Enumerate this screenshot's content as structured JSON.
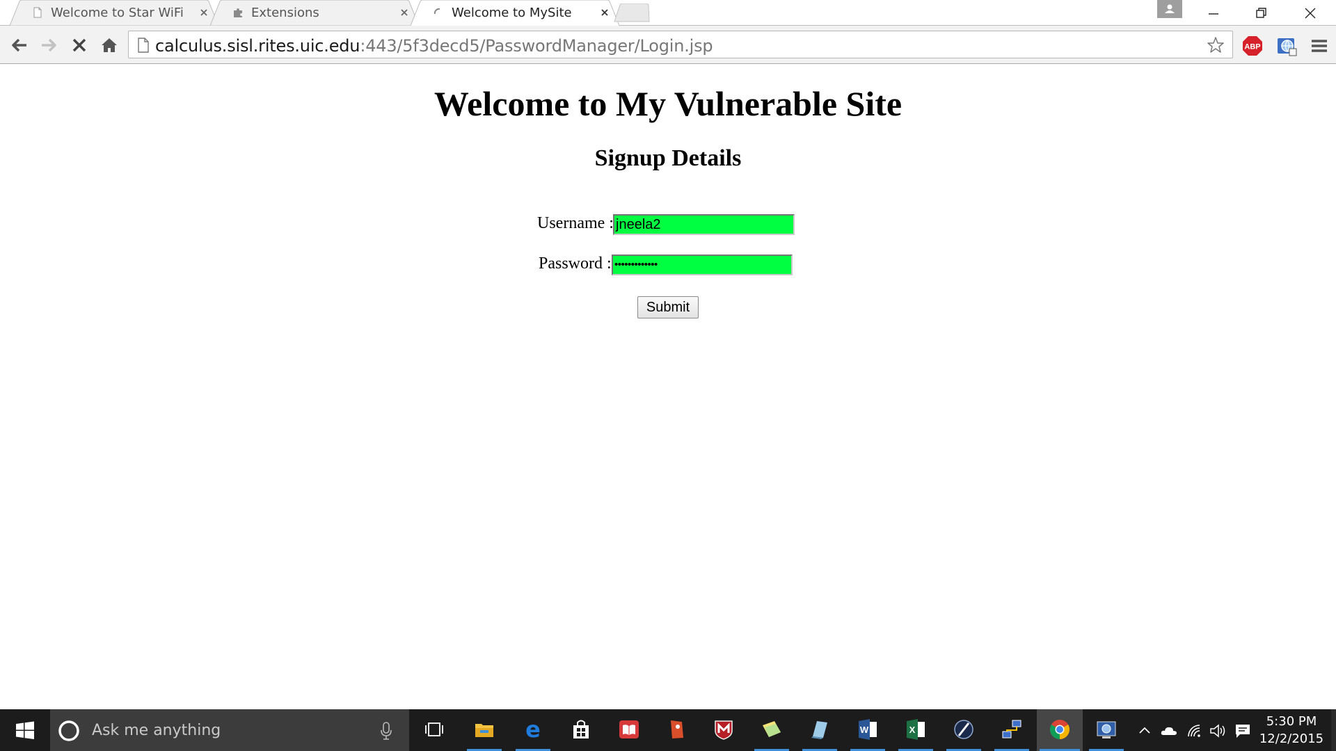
{
  "browser": {
    "tabs": [
      {
        "title": "Welcome to Star WiFi",
        "icon": "page-icon",
        "active": false
      },
      {
        "title": "Extensions",
        "icon": "puzzle-icon",
        "active": false
      },
      {
        "title": "Welcome to MySite",
        "icon": "loading-spinner-icon",
        "active": true
      }
    ],
    "url_host": "calculus.sisl.rites.uic.edu",
    "url_rest": ":443/5f3decd5/PasswordManager/Login.jsp",
    "extensions": [
      {
        "name": "adblock-plus-icon",
        "label": "ABP"
      },
      {
        "name": "extension-globe-icon"
      }
    ]
  },
  "page": {
    "title": "Welcome to My Vulnerable Site",
    "subtitle": "Signup Details",
    "username_label": "Username :",
    "username_value": "jneela2",
    "password_label": "Password :",
    "password_value": "•••••••••••••",
    "submit_label": "Submit",
    "field_color": "#00ff40"
  },
  "taskbar": {
    "search_placeholder": "Ask me anything",
    "pinned": [
      "task-view-icon",
      "file-explorer-icon",
      "edge-icon",
      "store-icon",
      "reader-icon",
      "sketch-app-icon",
      "mcafee-icon",
      "sticky-notes-icon",
      "notepad-app-icon",
      "word-icon",
      "excel-icon",
      "remote-tool-icon",
      "network-app-icon",
      "chrome-icon",
      "control-panel-icon"
    ],
    "time": "5:30 PM",
    "date": "12/2/2015"
  }
}
